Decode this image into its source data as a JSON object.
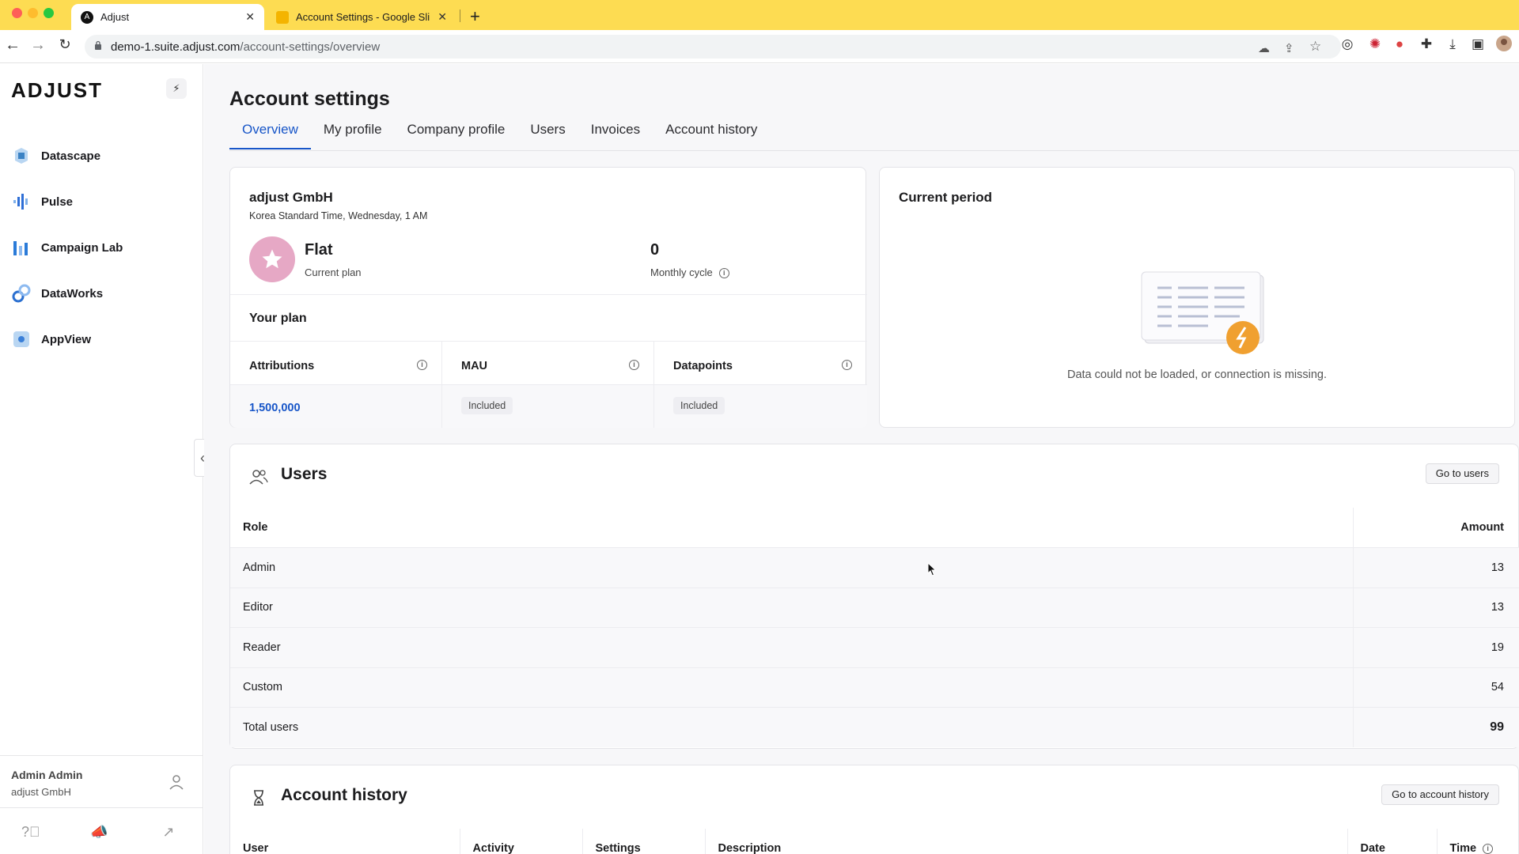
{
  "browser": {
    "tabs": [
      {
        "title": "Adjust",
        "active": true
      },
      {
        "title": "Account Settings - Google Sli",
        "active": false
      }
    ],
    "url_host": "demo-1.suite.adjust.com",
    "url_path": "/account-settings/overview",
    "icons": [
      "back-icon",
      "forward-icon",
      "reload-icon",
      "lock-icon",
      "cloud-icon",
      "share-icon",
      "star-icon",
      "screenshot-icon",
      "extension-icon",
      "puzzle-icon",
      "download-icon",
      "sidepanel-icon",
      "profile-avatar"
    ]
  },
  "sidebar": {
    "logo": "ADJUST",
    "items": [
      {
        "label": "Datascape",
        "icon": "datascape-icon",
        "color": "#3b82c4"
      },
      {
        "label": "Pulse",
        "icon": "pulse-icon",
        "color": "#2f6fd6"
      },
      {
        "label": "Campaign Lab",
        "icon": "campaign-lab-icon",
        "color": "#2b7bd8"
      },
      {
        "label": "DataWorks",
        "icon": "dataworks-icon",
        "color": "#2a6fd0"
      },
      {
        "label": "AppView",
        "icon": "appview-icon",
        "color": "#3a7fd8"
      }
    ],
    "user": {
      "name": "Admin Admin",
      "company": "adjust GmbH"
    }
  },
  "page": {
    "title": "Account settings",
    "tabs": [
      "Overview",
      "My profile",
      "Company profile",
      "Users",
      "Invoices",
      "Account history"
    ],
    "active_tab": "Overview"
  },
  "company_card": {
    "name": "adjust GmbH",
    "timezone": "Korea Standard Time, Wednesday, 1 AM",
    "plan_name": "Flat",
    "plan_label": "Current plan",
    "cycle_value": "0",
    "cycle_label": "Monthly cycle",
    "your_plan": "Your plan",
    "columns": [
      {
        "header": "Attributions",
        "value": "1,500,000",
        "type": "value"
      },
      {
        "header": "MAU",
        "value": "Included",
        "type": "pill"
      },
      {
        "header": "Datapoints",
        "value": "Included",
        "type": "pill"
      }
    ]
  },
  "current_period": {
    "title": "Current period",
    "message": "Data could not be loaded, or connection is missing."
  },
  "users_section": {
    "title": "Users",
    "button": "Go to users",
    "col_role": "Role",
    "col_amount": "Amount",
    "rows": [
      {
        "role": "Admin",
        "amount": "13"
      },
      {
        "role": "Editor",
        "amount": "13"
      },
      {
        "role": "Reader",
        "amount": "19"
      },
      {
        "role": "Custom",
        "amount": "54"
      },
      {
        "role": "Total users",
        "amount": "99"
      }
    ]
  },
  "history_section": {
    "title": "Account history",
    "button": "Go to account history",
    "columns": [
      "User",
      "Activity",
      "Settings",
      "Description",
      "Date",
      "Time"
    ]
  },
  "colors": {
    "accent": "#1856c8",
    "tabbar": "#fddc52",
    "plan_badge": "#e6a8c5",
    "warning": "#f0a030"
  }
}
